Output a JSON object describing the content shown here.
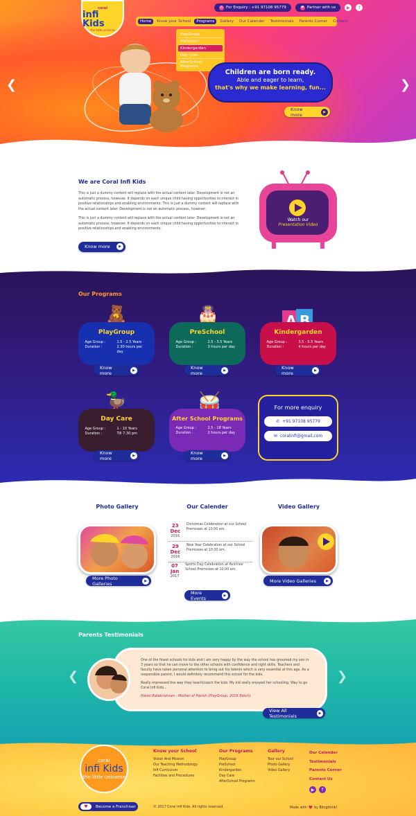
{
  "header": {
    "logo_small": "coral",
    "logo_main": "infi Kids",
    "logo_tag": "the little universe",
    "enquiry_label": "For Enquiry : +91 97108 95779",
    "partner_label": "Partner with us",
    "nav": [
      "Home",
      "Know your School",
      "Programs",
      "Gallery",
      "Our Calender",
      "Testimonials",
      "Parents Corner",
      "Contact"
    ],
    "programs_dropdown": [
      "PlayGroup",
      "PreSchool",
      "Kindergarden",
      "Day Care",
      "AfterSchool Programs"
    ]
  },
  "hero": {
    "line1": "Children are born ready.",
    "line2": "Able and eager to learn,",
    "line3": "that's why we make learning, fun...",
    "button": "Know more"
  },
  "about": {
    "title": "We are Coral Infi Kids",
    "para1": "This is just a dummy content will replace with the actual content later. Development is not an automatic process, however. It depends on each unique child having opportunities to interact in positive relationships and enabling environments. This is just a dummy content will replace with the actual content later. Development is not an automatic process, however.",
    "para2": "This is just a dummy content will replace with the actual content later. Development is not an automatic process, however. It depends on each unique child having opportunities to interact in positive relationships and enabling environments.",
    "button": "Know more",
    "video_label1": "Watch our",
    "video_label2": "Presentation Video"
  },
  "programs": {
    "title": "Our Programs",
    "age_label": "Age Group :",
    "duration_label": "Duration :",
    "button": "Know more",
    "cards": [
      {
        "name": "PlayGroup",
        "age": "1.5 - 2.5 Years",
        "duration": "2.30 hours per day",
        "color": "#1730b0"
      },
      {
        "name": "PreSchool",
        "age": "2.5 - 3.5 Years",
        "duration": "3 hours per day",
        "color": "#0d6a5a"
      },
      {
        "name": "Kindergarden",
        "age": "3.5 - 5.5 Years",
        "duration": "4 hours per day",
        "color": "#c90f4a"
      },
      {
        "name": "Day Care",
        "age": "1 - 10 Years",
        "duration": "Till 7.30 pm",
        "color": "#3a1d2e"
      },
      {
        "name": "After School Programs",
        "age": "2.5 - 18 Years",
        "duration": "2 hours per day",
        "color": "#7a2ab5"
      }
    ],
    "enquiry_title": "For more enquiry",
    "enquiry_phone": "+91 97108 95779",
    "enquiry_email": "coralinfi@gmail.com"
  },
  "gallery": {
    "photo_title": "Photo Gallery",
    "photo_button": "More Photo Galleries",
    "calendar_title": "Our Calender",
    "events": [
      {
        "date": "23 Dec",
        "year": "2016",
        "text": "Christmas Celebration at our School Premisses at 10.00 am."
      },
      {
        "date": "29 Dec",
        "year": "2016",
        "text": "New Year Celebration at our School Premisses at 10.00 am."
      },
      {
        "date": "07 Jan",
        "year": "2017",
        "text": "Sports Day Celebration at Avichiee School Premisses at 10.00 am."
      }
    ],
    "events_button": "More Events",
    "video_title": "Video Gallery",
    "video_button": "More Video Galleries"
  },
  "testimonials": {
    "title": "Parents Testimonials",
    "para1": "One of the finest schools for kids and I am very happy by the way the school has groomed my son in 3 years so that he can move to the other schools with confidence and right skills. Teachers and faculty have taken personal attention to bring out his talents which is very essential at this age. As a responsible parent, I would definitely recommend this school for the kids.",
    "para2": "Really impressed the way they teach/coach the kids. My kid really enjoyed her schooling. Way to go Coral Infi Kids...",
    "author": "Harini Balakrishnan - Mother of Harish (PlayGroup, 2016 Batch)",
    "button": "View All Testimonials"
  },
  "footer": {
    "col1_title": "Know your School",
    "col1_items": [
      "Vision And Mission",
      "Our Teaching Methodology",
      "Infi Curriculum",
      "Facilities and Procedures"
    ],
    "col2_title": "Our Programs",
    "col2_items": [
      "PlayGroup",
      "PreSchool",
      "Kindergarden",
      "Day Care",
      "AfterSchool Programs"
    ],
    "col3_title": "Gallery",
    "col3_items": [
      "Tour our School",
      "Photo Gallery",
      "Video Gallery"
    ],
    "col4_items": [
      "Our Calender",
      "Testimonials",
      "Parents Corner",
      "Contact Us"
    ],
    "franchise": "Become a Franchiser",
    "copyright": "© 2017 Coral Infi Kids. All rights reserved.",
    "made_with": "Made with",
    "made_by": "by Blingthink!"
  }
}
